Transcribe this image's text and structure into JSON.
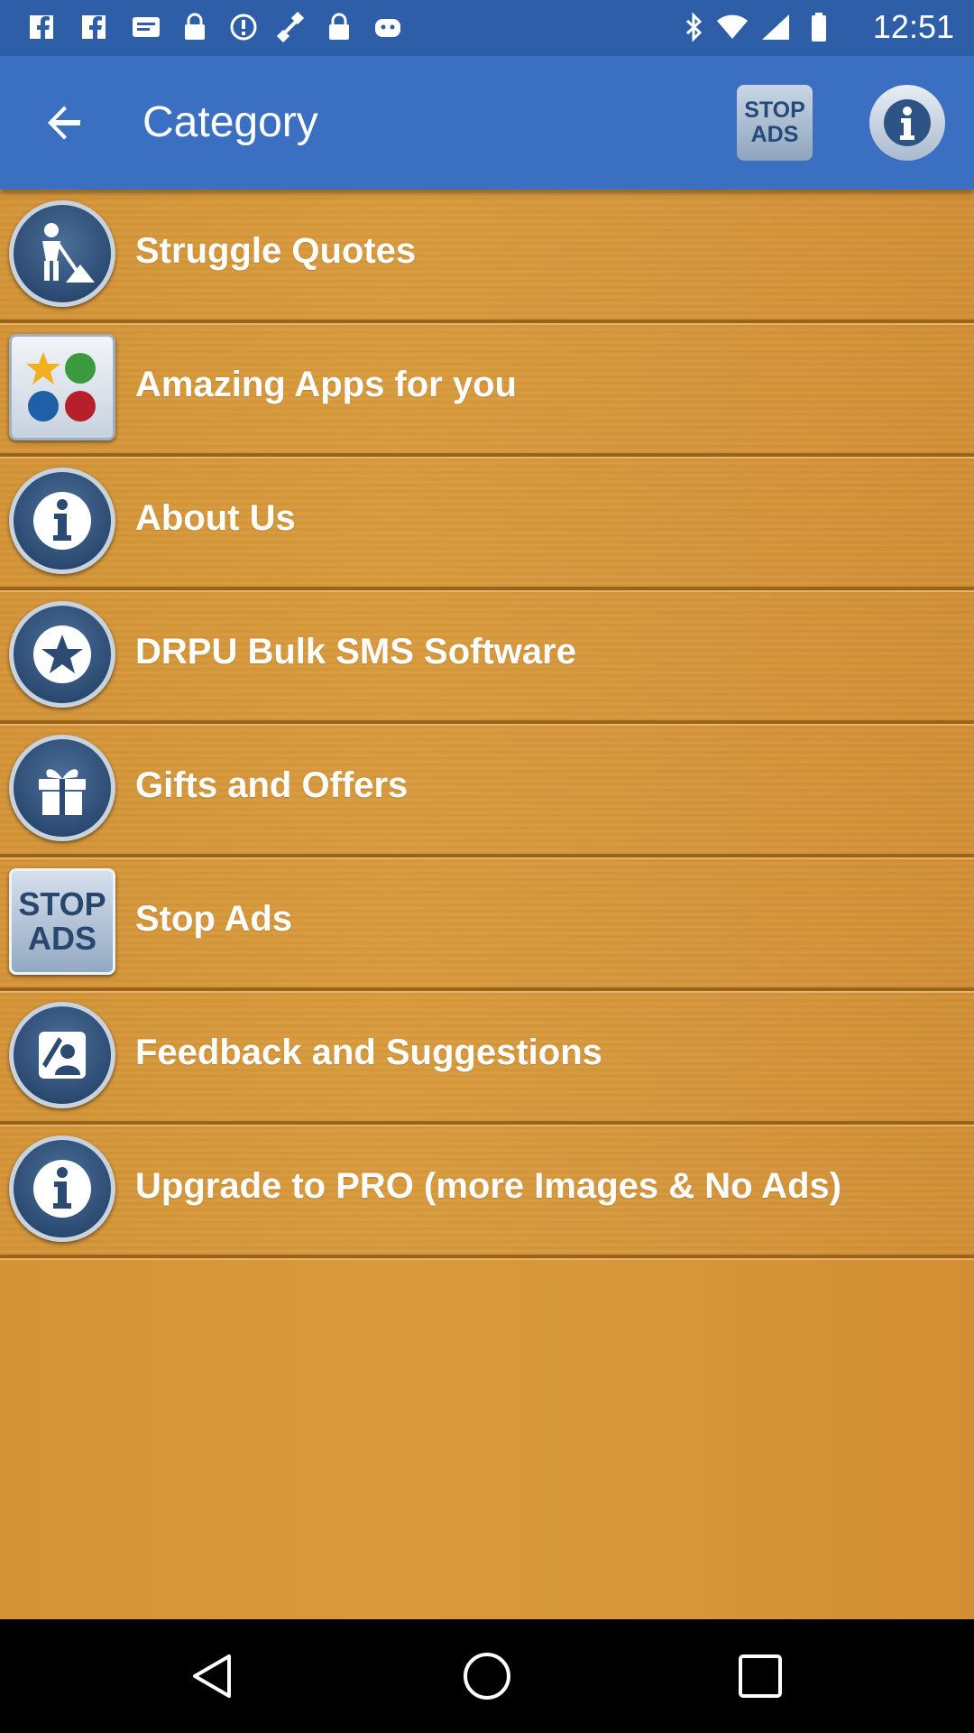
{
  "status_bar": {
    "time": "12:51",
    "left_icons": [
      "facebook-icon",
      "facebook-icon",
      "message-icon",
      "lock-icon",
      "disturb-icon",
      "fake-gps-icon",
      "lock-icon",
      "android-icon"
    ],
    "right_icons": [
      "bluetooth-icon",
      "wifi-icon",
      "signal-icon",
      "battery-icon"
    ]
  },
  "app_bar": {
    "title": "Category",
    "stop_ads": {
      "line1": "STOP",
      "line2": "ADS"
    }
  },
  "list": [
    {
      "label": "Struggle Quotes",
      "icon": "struggle-worker-icon"
    },
    {
      "label": "Amazing Apps for you",
      "icon": "apps-grid-icon"
    },
    {
      "label": "About Us",
      "icon": "info-icon"
    },
    {
      "label": "DRPU Bulk SMS Software",
      "icon": "star-icon"
    },
    {
      "label": "Gifts and Offers",
      "icon": "gift-icon"
    },
    {
      "label": "Stop Ads",
      "icon": "stop-ads-icon",
      "icon_text": {
        "line1": "STOP",
        "line2": "ADS"
      }
    },
    {
      "label": "Feedback and Suggestions",
      "icon": "feedback-icon"
    },
    {
      "label": "Upgrade to PRO (more Images & No Ads)",
      "icon": "info-icon"
    }
  ],
  "nav_bar": {
    "icons": [
      "back-icon",
      "home-icon",
      "recents-icon"
    ]
  },
  "colors": {
    "status_bar": "#2f5ea8",
    "app_bar": "#3a6fc2",
    "content_bg": "#d6963a",
    "row_text": "#ffffff"
  }
}
